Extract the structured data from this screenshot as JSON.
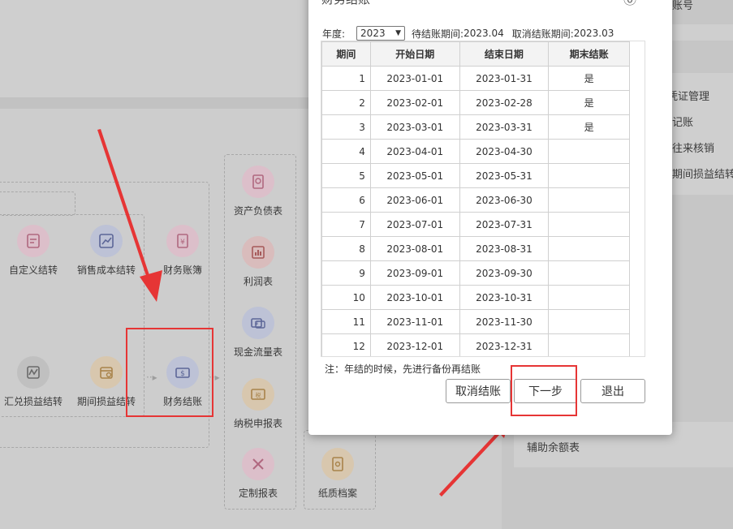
{
  "background": {
    "right_panel": {
      "items": [
        "账号",
        "凭证管理",
        "记账",
        "往来核销",
        "期间损益结转"
      ],
      "bottom_item": "辅助余额表"
    },
    "flow": {
      "custom_transfer": "自定义结转",
      "sales_cost_transfer": "销售成本结转",
      "ledger": "财务账簿",
      "fx_gain_loss_transfer": "汇兑损益结转",
      "period_pl_transfer": "期间损益结转",
      "closing": "财务结账",
      "balance_sheet": "资产负债表",
      "income_statement": "利润表",
      "cash_flow": "现金流量表",
      "tax_report": "纳税申报表",
      "custom_report": "定制报表",
      "paper_archive": "纸质档案"
    }
  },
  "modal": {
    "title": "财务结账",
    "year_label": "年度:",
    "year_value": "2023",
    "pending_label": "待结账期间:",
    "pending_value": "2023.04",
    "cancel_label": "取消结账期间:",
    "cancel_value": "2023.03",
    "columns": [
      "期间",
      "开始日期",
      "结束日期",
      "期末结账"
    ],
    "rows": [
      [
        "1",
        "2023-01-01",
        "2023-01-31",
        "是"
      ],
      [
        "2",
        "2023-02-01",
        "2023-02-28",
        "是"
      ],
      [
        "3",
        "2023-03-01",
        "2023-03-31",
        "是"
      ],
      [
        "4",
        "2023-04-01",
        "2023-04-30",
        ""
      ],
      [
        "5",
        "2023-05-01",
        "2023-05-31",
        ""
      ],
      [
        "6",
        "2023-06-01",
        "2023-06-30",
        ""
      ],
      [
        "7",
        "2023-07-01",
        "2023-07-31",
        ""
      ],
      [
        "8",
        "2023-08-01",
        "2023-08-31",
        ""
      ],
      [
        "9",
        "2023-09-01",
        "2023-09-30",
        ""
      ],
      [
        "10",
        "2023-10-01",
        "2023-10-31",
        ""
      ],
      [
        "11",
        "2023-11-01",
        "2023-11-30",
        ""
      ],
      [
        "12",
        "2023-12-01",
        "2023-12-31",
        ""
      ]
    ],
    "note": "注：年结的时候，先进行备份再结账",
    "btn_cancel": "取消结账",
    "btn_next": "下一步",
    "btn_exit": "退出"
  },
  "colors": {
    "annotation_red": "#e63535",
    "modal_bg": "#ffffff"
  }
}
